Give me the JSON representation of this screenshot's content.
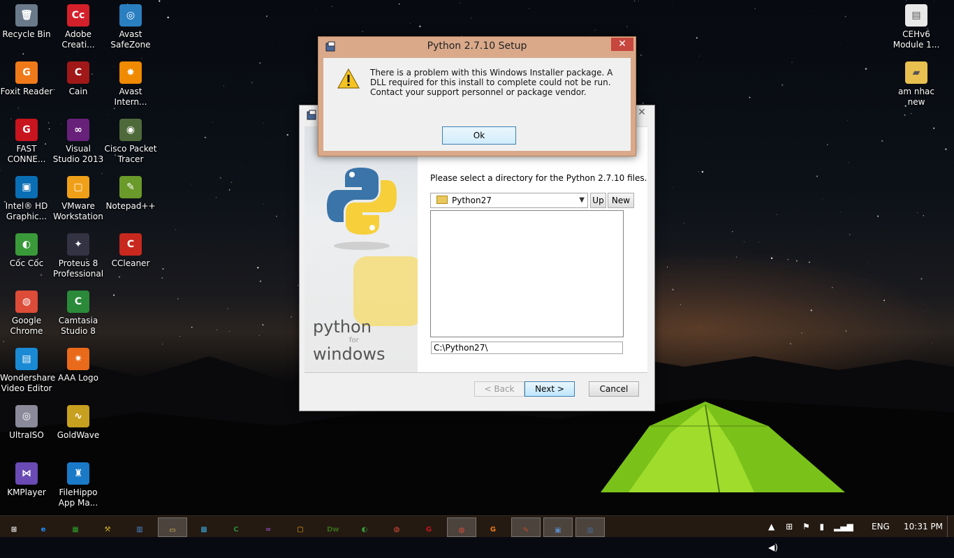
{
  "desktop": {
    "icons_left": [
      {
        "label": "Recycle Bin",
        "icon": "recycle-bin-icon",
        "glyph": "🗑",
        "color": "#6a7a8a"
      },
      {
        "label": "Adobe Creati...",
        "icon": "adobe-creative-cloud-icon",
        "glyph": "Cc",
        "color": "#d4202a"
      },
      {
        "label": "Avast SafeZone",
        "icon": "avast-safezone-icon",
        "glyph": "◎",
        "color": "#2a7fc1"
      },
      {
        "label": "Foxit Reader",
        "icon": "foxit-reader-icon",
        "glyph": "G",
        "color": "#f07a1a"
      },
      {
        "label": "Cain",
        "icon": "cain-icon",
        "glyph": "C",
        "color": "#a01818"
      },
      {
        "label": "Avast Intern...",
        "icon": "avast-internet-security-icon",
        "glyph": "✸",
        "color": "#f08a00"
      },
      {
        "label": "FAST CONNE...",
        "icon": "fast-connect-icon",
        "glyph": "G",
        "color": "#c8141e"
      },
      {
        "label": "Visual Studio 2013",
        "icon": "visual-studio-icon",
        "glyph": "∞",
        "color": "#68217a"
      },
      {
        "label": "Cisco Packet Tracer",
        "icon": "cisco-packet-tracer-icon",
        "glyph": "◉",
        "color": "#4f6a3a"
      },
      {
        "label": "Intel® HD Graphic...",
        "icon": "intel-hd-graphics-icon",
        "glyph": "▣",
        "color": "#0a6eb4"
      },
      {
        "label": "VMware Workstation",
        "icon": "vmware-icon",
        "glyph": "▢",
        "color": "#f0a018"
      },
      {
        "label": "Notepad++",
        "icon": "notepad-plus-plus-icon",
        "glyph": "✎",
        "color": "#6a9a2a"
      },
      {
        "label": "Cốc Cốc",
        "icon": "coc-coc-icon",
        "glyph": "◐",
        "color": "#3a9a3a"
      },
      {
        "label": "Proteus 8 Professional",
        "icon": "proteus-icon",
        "glyph": "✦",
        "color": "#334"
      },
      {
        "label": "CCleaner",
        "icon": "ccleaner-icon",
        "glyph": "C",
        "color": "#c8281e"
      },
      {
        "label": "Google Chrome",
        "icon": "chrome-icon",
        "glyph": "◍",
        "color": "#dd4b39"
      },
      {
        "label": "Camtasia Studio 8",
        "icon": "camtasia-icon",
        "glyph": "C",
        "color": "#2a8a3a"
      },
      {
        "label": "Wondershare Video Editor",
        "icon": "wondershare-video-editor-icon",
        "glyph": "▤",
        "color": "#1a8ad4"
      },
      {
        "label": "AAA Logo",
        "icon": "aaa-logo-icon",
        "glyph": "✷",
        "color": "#e86a1a"
      },
      {
        "label": "UltraISO",
        "icon": "ultraiso-icon",
        "glyph": "◎",
        "color": "#8a8a9a"
      },
      {
        "label": "GoldWave",
        "icon": "goldwave-icon",
        "glyph": "∿",
        "color": "#c8a020"
      },
      {
        "label": "KMPlayer",
        "icon": "kmplayer-icon",
        "glyph": "⋈",
        "color": "#6a4ab4"
      },
      {
        "label": "FileHippo App Ma...",
        "icon": "filehippo-icon",
        "glyph": "♜",
        "color": "#1a7ac8"
      }
    ],
    "icons_right": [
      {
        "label": "CEHv6 Module 1...",
        "icon": "document-icon",
        "glyph": "▤",
        "color": "#e8e8e8"
      },
      {
        "label": "am nhac new",
        "icon": "folder-icon",
        "glyph": "▰",
        "color": "#e8c050"
      }
    ]
  },
  "setup_window": {
    "close_glyph": "✕",
    "banner_text1": "python",
    "banner_text2": "for",
    "banner_text3": "windows",
    "prompt": "Please select a directory for the Python 2.7.10 files.",
    "directory_selected": "Python27",
    "up_label": "Up",
    "new_label": "New",
    "path_value": "C:\\Python27\\",
    "back_label": "< Back",
    "next_label": "Next >",
    "cancel_label": "Cancel"
  },
  "error_dialog": {
    "title": "Python 2.7.10 Setup",
    "close_glyph": "✕",
    "message": "There is a problem with this Windows Installer package. A DLL required for this install to complete could not be run. Contact your support personnel or package vendor.",
    "ok_label": "Ok"
  },
  "taskbar": {
    "items": [
      {
        "icon": "start-icon",
        "glyph": "⊞",
        "color": "#ffffff"
      },
      {
        "icon": "internet-explorer-icon",
        "glyph": "e",
        "color": "#1e90ff"
      },
      {
        "icon": "store-icon",
        "glyph": "▦",
        "color": "#2aa02a"
      },
      {
        "icon": "tool-icon",
        "glyph": "⚒",
        "color": "#d0b020"
      },
      {
        "icon": "installer-icon",
        "glyph": "▥",
        "color": "#4a8ad0"
      },
      {
        "icon": "file-explorer-icon",
        "glyph": "▭",
        "color": "#e8c050"
      },
      {
        "icon": "media-icon",
        "glyph": "▩",
        "color": "#3aa0d0"
      },
      {
        "icon": "camtasia-taskbar-icon",
        "glyph": "C",
        "color": "#2a8a3a"
      },
      {
        "icon": "visual-studio-taskbar-icon",
        "glyph": "∞",
        "color": "#8a4ab4"
      },
      {
        "icon": "vmware-taskbar-icon",
        "glyph": "▢",
        "color": "#f0a018"
      },
      {
        "icon": "dreamweaver-icon",
        "glyph": "Dw",
        "color": "#3a6a1a"
      },
      {
        "icon": "coc-coc-taskbar-icon",
        "glyph": "◐",
        "color": "#3a9a3a"
      },
      {
        "icon": "chrome-taskbar-icon",
        "glyph": "◍",
        "color": "#dd4b39"
      },
      {
        "icon": "fast-connect-taskbar-icon",
        "glyph": "G",
        "color": "#c8141e"
      },
      {
        "icon": "chrome-window-icon",
        "glyph": "◍",
        "color": "#dd4b39"
      },
      {
        "icon": "foxit-taskbar-icon",
        "glyph": "G",
        "color": "#f07a1a"
      },
      {
        "icon": "installer2-icon",
        "glyph": "✎",
        "color": "#c84a2a"
      },
      {
        "icon": "network-app-icon",
        "glyph": "▣",
        "color": "#5a8ac8"
      },
      {
        "icon": "python-setup-taskbar-icon",
        "glyph": "▥",
        "color": "#4a6a9a"
      }
    ],
    "language": "ENG",
    "time": "10:31 PM"
  }
}
